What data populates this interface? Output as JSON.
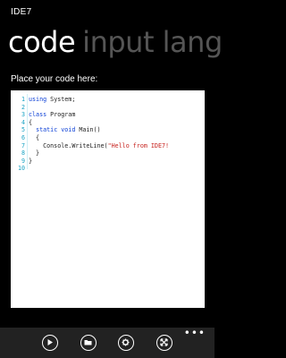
{
  "app": {
    "title": "IDE7"
  },
  "pivot": {
    "active": "code",
    "next": "input lang"
  },
  "prompt": "Place your code here:",
  "code_lines": [
    {
      "n": "1",
      "parts": [
        {
          "t": "using",
          "c": "kw"
        },
        {
          "t": " System;",
          "c": "txt"
        }
      ]
    },
    {
      "n": "2",
      "parts": []
    },
    {
      "n": "3",
      "parts": [
        {
          "t": "class",
          "c": "kw"
        },
        {
          "t": " Program",
          "c": "txt"
        }
      ]
    },
    {
      "n": "4",
      "parts": [
        {
          "t": "{",
          "c": "txt"
        }
      ]
    },
    {
      "n": "5",
      "parts": [
        {
          "t": "  ",
          "c": "txt"
        },
        {
          "t": "static void",
          "c": "kw"
        },
        {
          "t": " Main()",
          "c": "txt"
        }
      ]
    },
    {
      "n": "6",
      "parts": [
        {
          "t": "  {",
          "c": "txt"
        }
      ]
    },
    {
      "n": "7",
      "parts": [
        {
          "t": "    Console.WriteLine(",
          "c": "txt"
        },
        {
          "t": "\"Hello from IDE7!",
          "c": "str"
        }
      ]
    },
    {
      "n": "8",
      "parts": [
        {
          "t": "  }",
          "c": "txt"
        }
      ]
    },
    {
      "n": "9",
      "parts": [
        {
          "t": "}",
          "c": "txt"
        }
      ]
    },
    {
      "n": "10",
      "parts": []
    }
  ],
  "appbar": {
    "buttons": [
      "play-icon",
      "folder-icon",
      "settings-icon",
      "fullscreen-icon"
    ],
    "more": "•••"
  }
}
